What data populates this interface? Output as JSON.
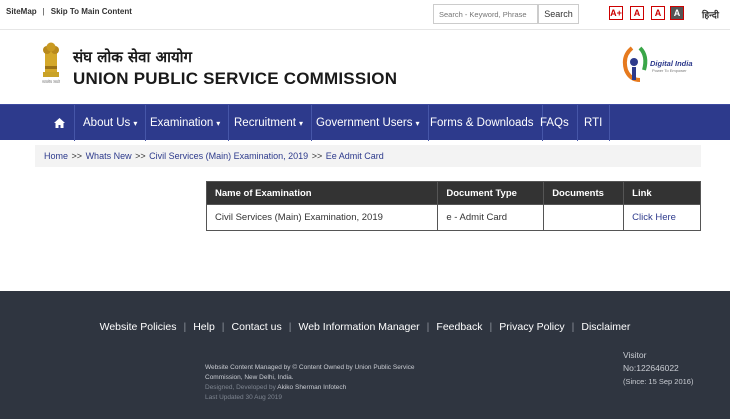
{
  "topbar": {
    "sitemap": "SiteMap",
    "separator": "|",
    "skip": "Skip To Main Content",
    "search_placeholder": "Search - Keyword, Phrase",
    "search_button": "Search",
    "font_buttons": [
      "A+",
      "A",
      "A",
      "A"
    ],
    "hindi": "हिन्दी"
  },
  "header": {
    "title_hindi": "संघ लोक सेवा आयोग",
    "title_english": "UNION PUBLIC SERVICE COMMISSION",
    "emblem_caption": "सत्यमेव जयते",
    "digital_india": "Digital India",
    "digital_india_tagline": "Power To Empower"
  },
  "nav": {
    "home_icon": "home-icon",
    "items": [
      {
        "label": "About Us",
        "dropdown": "▾"
      },
      {
        "label": "Examination",
        "dropdown": "▾"
      },
      {
        "label": "Recruitment",
        "dropdown": "▾"
      },
      {
        "label": "Government Users",
        "dropdown": "▾"
      },
      {
        "label": "Forms & Downloads",
        "dropdown": ""
      },
      {
        "label": "FAQs",
        "dropdown": ""
      },
      {
        "label": "RTI",
        "dropdown": ""
      }
    ]
  },
  "breadcrumb": {
    "items": [
      "Home",
      "Whats New",
      "Civil Services (Main) Examination, 2019",
      "Ee Admit Card"
    ],
    "separator": ">>"
  },
  "table": {
    "headers": [
      "Name of Examination",
      "Document Type",
      "Documents",
      "Link"
    ],
    "rows": [
      {
        "name": "Civil Services (Main) Examination, 2019",
        "doc_type": "e - Admit Card",
        "documents": "",
        "link": "Click Here"
      }
    ]
  },
  "footer": {
    "links": [
      "Website Policies",
      "Help",
      "Contact us",
      "Web Information Manager",
      "Feedback",
      "Privacy Policy",
      "Disclaimer"
    ],
    "info_line1": "Website Content Managed by © Content Owned by Union Public Service",
    "info_line2": "Commission, New Delhi, India.",
    "info_designed": "Designed, Developed by",
    "info_designer": "Akiko Sherman Infotech",
    "info_updated": "Last Updated 30 Aug 2019",
    "visitor_label": "Visitor",
    "visitor_count": "No:122646022",
    "visitor_since": "(Since: 15 Sep 2016)"
  },
  "colors": {
    "nav_bg": "#2d3a8c",
    "footer_bg": "#2f3540",
    "table_header_bg": "#333333",
    "link": "#2d3a8c",
    "font_button_border": "#cc0000"
  }
}
